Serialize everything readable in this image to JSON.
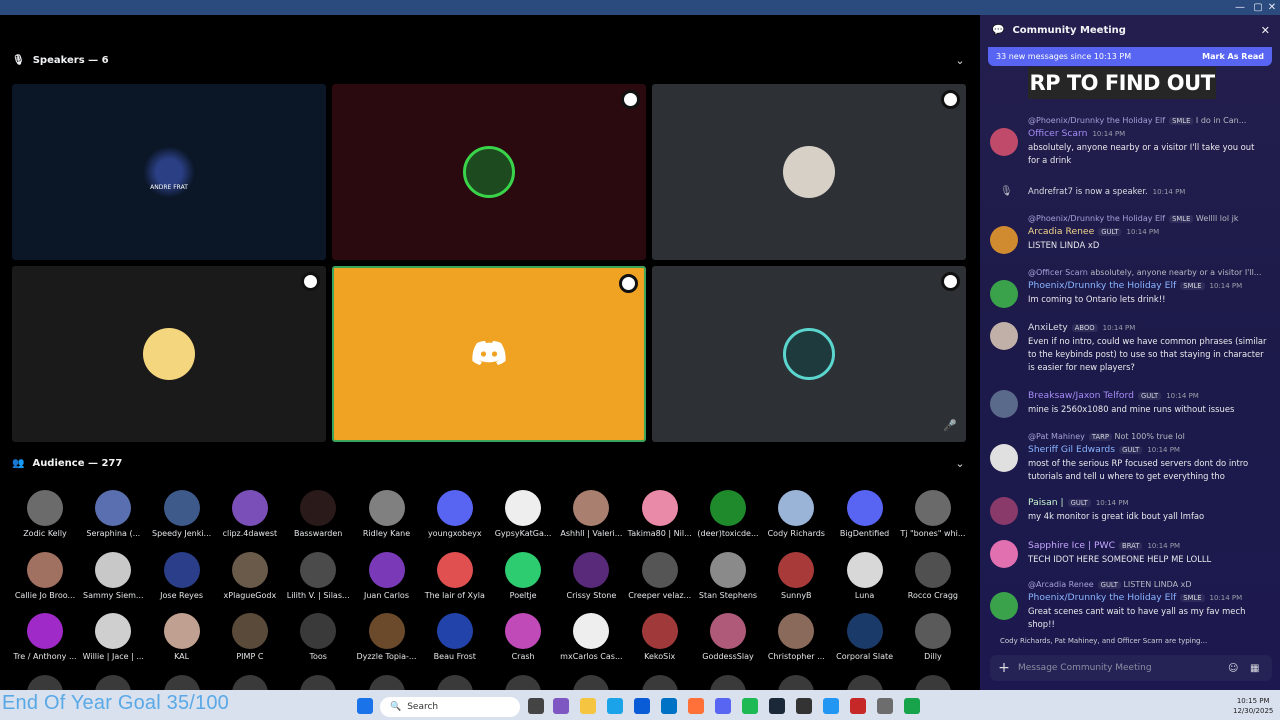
{
  "window": {
    "minimize": "—",
    "maximize": "▢",
    "close": "✕"
  },
  "stage": {
    "speakers_header": "Speakers — 6",
    "audience_header": "Audience — 277",
    "tile_texts": {
      "andre_frat": "ANDRE FRAT"
    }
  },
  "audience": [
    "Zodic Kelly",
    "Seraphina (...",
    "Speedy Jenki...",
    "clipz.4dawest",
    "Basswarden",
    "Ridley Kane",
    "youngxobeyx",
    "GypsyKatGa...",
    "Ashhll | Valeri...",
    "Takima80 | Nil...",
    "(deer)toxicde...",
    "Cody Richards",
    "BigDentified",
    "Tj \"bones\" whi...",
    "Callie Jo Broo...",
    "Sammy Siem...",
    "Jose Reyes",
    "xPlagueGodx",
    "Lilith V. | Silas...",
    "Juan Carlos",
    "The lair of Xyla",
    "Poeltje",
    "Crissy Stone",
    "Creeper velaz...",
    "Stan Stephens",
    "SunnyB",
    "Luna",
    "Rocco Cragg",
    "Tre / Anthony ...",
    "Willie | Jace | ...",
    "KAL",
    "PIMP C",
    "Toos",
    "Dyzzle Topia-...",
    "Beau Frost",
    "Crash",
    "mxCarlos Cas...",
    "KekoSix",
    "GoddessSlay",
    "Christopher ...",
    "Corporal Slate",
    "Dilly"
  ],
  "chat": {
    "title": "Community Meeting",
    "new_messages": "33 new messages since 10:13 PM",
    "mark_read": "Mark As Read",
    "banner": "RP TO FIND OUT",
    "typing": "Cody Richards, Pat Mahiney, and Officer Scarn are typing...",
    "placeholder": "Message Community Meeting",
    "messages": [
      {
        "reply_name": "@Phoenix/Drunnky the Holiday Elf",
        "reply_tag": "SMLE",
        "reply_text": "I do in Can...",
        "author": "Officer Scarn",
        "time": "10:14 PM",
        "body": "absolutely, anyone nearby or a visitor I'll take you out for a drink"
      },
      {
        "system": "Andrefrat7 is now a speaker.",
        "time": "10:14 PM"
      },
      {
        "reply_name": "@Phoenix/Drunnky the Holiday Elf",
        "reply_tag": "SMLE",
        "reply_text": "Wellll lol jk",
        "author": "Arcadia Renee",
        "tag": "GULT",
        "time": "10:14 PM",
        "body": "LISTEN LINDA xD"
      },
      {
        "reply_name": "@Officer Scarn",
        "reply_text": "absolutely, anyone nearby or a visitor I'll...",
        "author": "Phoenix/Drunnky the Holiday Elf",
        "tag": "SMLE",
        "time": "10:14 PM",
        "body": "Im coming to Ontario lets drink!!"
      },
      {
        "author": "AnxiLety",
        "tag": "ABOO",
        "time": "10:14 PM",
        "body": "Even if no intro, could we have common phrases (similar to the keybinds post) to use so that staying in character is easier for new players?"
      },
      {
        "author": "Breaksaw/Jaxon Telford",
        "tag": "GULT",
        "time": "10:14 PM",
        "body": "mine is 2560x1080 and mine runs without issues"
      },
      {
        "reply_name": "@Pat Mahiney",
        "reply_tag": "TARP",
        "reply_text": "Not 100% true lol",
        "author": "Sheriff Gil Edwards",
        "tag": "GULT",
        "time": "10:14 PM",
        "body": "most of the serious RP focused servers dont do intro tutorials and tell u where to get everything tho"
      },
      {
        "author": "Paisan |",
        "tag": "GULT",
        "time": "10:14 PM",
        "body": "my 4k monitor is great idk bout yall lmfao"
      },
      {
        "author": "Sapphire Ice | PWC",
        "tag": "BRAT",
        "time": "10:14 PM",
        "body": "TECH IDOT HERE SOMEONE HELP ME LOLLL"
      },
      {
        "reply_name": "@Arcadia Renee",
        "reply_tag": "GULT",
        "reply_text": "LISTEN LINDA xD",
        "author": "Phoenix/Drunnky the Holiday Elf",
        "tag": "SMLE",
        "time": "10:14 PM",
        "body": "Great scenes cant wait to have yall as my fav mech shop!!"
      }
    ]
  },
  "taskbar": {
    "goal": "End Of Year Goal 35/100",
    "search": "Search",
    "time": "10:15 PM",
    "date": "12/30/2025"
  },
  "colors": {
    "accent": "#5865f2",
    "speaking_tile": "#f0a323",
    "speaking_border": "#3ba55c"
  }
}
